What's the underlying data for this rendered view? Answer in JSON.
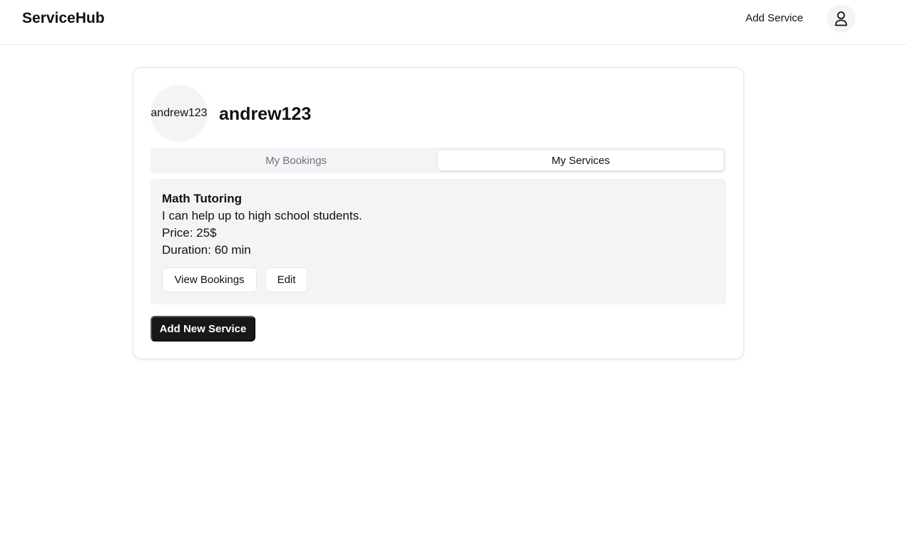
{
  "header": {
    "brand": "ServiceHub",
    "add_service_link": "Add Service",
    "user_icon": "user-icon"
  },
  "profile": {
    "avatar_text": "andrew123",
    "username": "andrew123"
  },
  "tabs": [
    {
      "label": "My Bookings",
      "active": false
    },
    {
      "label": "My Services",
      "active": true
    }
  ],
  "services": [
    {
      "title": "Math Tutoring",
      "description": "I can help up to high school students.",
      "price": "Price: 25$",
      "duration": "Duration: 60 min",
      "view_bookings_label": "View Bookings",
      "edit_label": "Edit"
    }
  ],
  "actions": {
    "add_new_service_label": "Add New Service"
  },
  "colors": {
    "primary_button": "#18181b",
    "surface_muted": "#f3f4f6",
    "border": "#e5e7eb",
    "text_muted": "#6b7280"
  }
}
